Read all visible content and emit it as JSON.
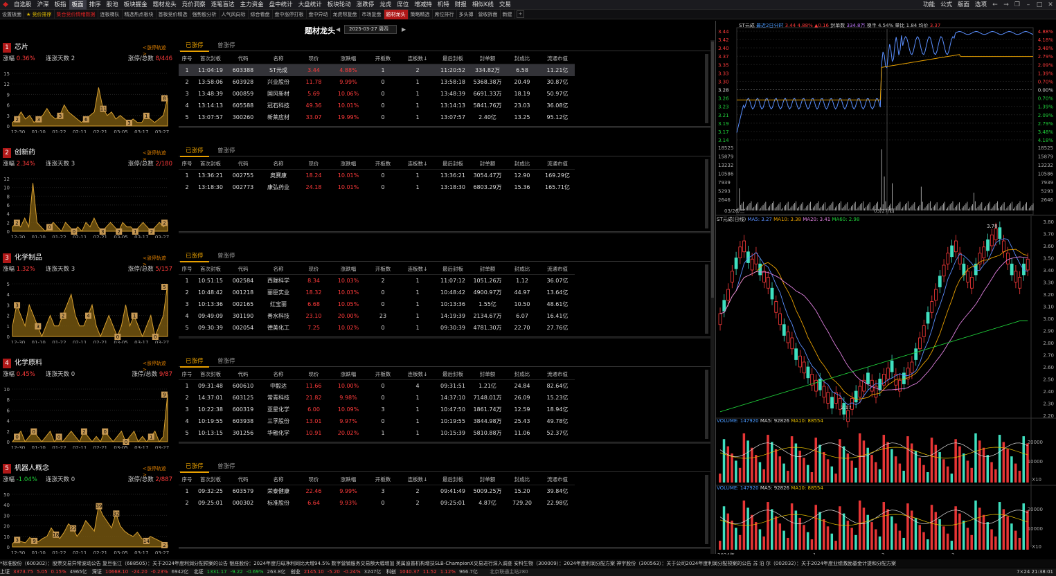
{
  "menubar": {
    "items": [
      "自选股",
      "沪深",
      "板指",
      "板面",
      "排序",
      "股池",
      "板块掘金",
      "题材龙头",
      "竞价洞察",
      "逐笔盲达",
      "主力资金",
      "盘中统计",
      "大盘统计",
      "板块轮动",
      "涨跌停",
      "龙虎",
      "席位",
      "增减持",
      "机特",
      "财报",
      "相似K线",
      "交易"
    ],
    "active": "板面",
    "right": [
      "功能",
      "公式",
      "版面",
      "选项"
    ]
  },
  "toolbar": {
    "items": [
      "设置板面",
      "★ 竞价排序",
      "集合竞价情绪数据",
      "连板梯队",
      "精选热点板块",
      "首板竞价精选",
      "强势股分析",
      "人气风向标",
      "综合看盘",
      "盘中涨停打板",
      "盘中异动",
      "龙虎帮复盘",
      "市场复盘",
      "题材龙头",
      "策略精选",
      "席位排行",
      "多头搏",
      "营收拆面",
      "新建"
    ],
    "active": "题材龙头"
  },
  "page": {
    "title": "题材龙头",
    "date": "2025-03-27 周四"
  },
  "tabs": [
    "已涨停",
    "曾涨停"
  ],
  "columns": [
    "序号",
    "首次封板",
    "代码",
    "名称",
    "现价",
    "涨跌幅",
    "开板数",
    "连板数↓",
    "最后封板",
    "封单额",
    "封成比",
    "流通市值"
  ],
  "sectors": [
    {
      "rank": "1",
      "name": "芯片",
      "track": "<涨停轨迹>",
      "change": "0.36%",
      "dir": "up",
      "days": "2",
      "limit": "8/446",
      "chart": {
        "labels": [
          "12-30",
          "01-10",
          "01-22",
          "02-11",
          "02-21",
          "03-05",
          "03-17",
          "03-27"
        ],
        "yticks": [
          "15",
          "12",
          "9",
          "6",
          "3",
          "0"
        ],
        "ymax": 15,
        "series": [
          1,
          2,
          4,
          2,
          3,
          1,
          2,
          3,
          5,
          3,
          2,
          3,
          6,
          4,
          3,
          2,
          1,
          2,
          3,
          4,
          11,
          5,
          3,
          4,
          2,
          3,
          2,
          1,
          2,
          1,
          1,
          3,
          2,
          1,
          2,
          3,
          8
        ],
        "labels_on": [
          {
            "i": 1,
            "v": "2"
          },
          {
            "i": 6,
            "v": "3"
          },
          {
            "i": 11,
            "v": "3"
          },
          {
            "i": 17,
            "v": "6"
          },
          {
            "i": 21,
            "v": "11"
          },
          {
            "i": 27,
            "v": "3"
          },
          {
            "i": 31,
            "v": "1"
          },
          {
            "i": 36,
            "v": "8"
          }
        ]
      },
      "rows": [
        [
          "1",
          "11:04:19",
          "603388",
          "ST元成",
          "3.44",
          "4.88%",
          "1",
          "2",
          "11:20:52",
          "334.82万",
          "6.58",
          "11.21亿"
        ],
        [
          "2",
          "13:58:06",
          "603928",
          "兴业股份",
          "11.78",
          "9.99%",
          "0",
          "1",
          "13:58:18",
          "5368.38万",
          "20.49",
          "30.87亿"
        ],
        [
          "3",
          "13:48:39",
          "000859",
          "国风新材",
          "5.69",
          "10.06%",
          "0",
          "1",
          "13:48:39",
          "6691.33万",
          "18.19",
          "50.97亿"
        ],
        [
          "4",
          "13:14:13",
          "605588",
          "冠石科技",
          "49.36",
          "10.01%",
          "0",
          "1",
          "13:14:13",
          "5841.76万",
          "23.03",
          "36.08亿"
        ],
        [
          "5",
          "13:07:57",
          "300260",
          "新莱应材",
          "33.07",
          "19.99%",
          "0",
          "1",
          "13:07:57",
          "2.40亿",
          "13.25",
          "95.12亿"
        ]
      ]
    },
    {
      "rank": "2",
      "name": "创新药",
      "track": "<涨停轨迹>",
      "change": "2.34%",
      "dir": "up",
      "days": "3",
      "limit": "2/180",
      "chart": {
        "labels": [
          "12-30",
          "01-10",
          "01-22",
          "02-11",
          "02-21",
          "03-05",
          "03-17",
          "03-27"
        ],
        "yticks": [
          "12",
          "10",
          "8",
          "6",
          "4",
          "2",
          "0"
        ],
        "ymax": 12,
        "series": [
          1,
          2,
          1,
          3,
          1,
          11,
          2,
          1,
          0,
          1,
          2,
          1,
          0,
          2,
          1,
          0,
          1,
          0,
          2,
          1,
          3,
          1,
          0,
          1,
          2,
          1,
          0,
          2,
          1,
          1,
          0,
          1,
          2,
          1,
          0,
          1,
          2,
          1,
          2
        ],
        "labels_on": [
          {
            "i": 1,
            "v": "2"
          },
          {
            "i": 9,
            "v": "0"
          },
          {
            "i": 15,
            "v": "0"
          },
          {
            "i": 22,
            "v": "3"
          },
          {
            "i": 26,
            "v": "2"
          },
          {
            "i": 30,
            "v": "1"
          },
          {
            "i": 34,
            "v": "2"
          },
          {
            "i": 38,
            "v": "2"
          }
        ]
      },
      "rows": [
        [
          "1",
          "13:36:21",
          "002755",
          "奥赛康",
          "18.24",
          "10.01%",
          "0",
          "1",
          "13:36:21",
          "3054.47万",
          "12.90",
          "169.29亿"
        ],
        [
          "2",
          "13:18:30",
          "002773",
          "康弘药业",
          "24.18",
          "10.01%",
          "0",
          "1",
          "13:18:30",
          "6803.29万",
          "15.36",
          "165.71亿"
        ]
      ]
    },
    {
      "rank": "3",
      "name": "化学制品",
      "track": "<涨停轨迹>",
      "change": "1.32%",
      "dir": "up",
      "days": "3",
      "limit": "5/157",
      "chart": {
        "labels": [
          "12-30",
          "01-10",
          "01-22",
          "02-11",
          "02-21",
          "03-05",
          "03-17",
          "03-27"
        ],
        "yticks": [
          "5",
          "4",
          "3",
          "2",
          "1",
          "0"
        ],
        "ymax": 5,
        "series": [
          1,
          3,
          2,
          1,
          3,
          2,
          1,
          0,
          1,
          2,
          1,
          1,
          2,
          3,
          4,
          2,
          1,
          1,
          2,
          3,
          1,
          0,
          1,
          2,
          1,
          0,
          1,
          3,
          1,
          2,
          1,
          0,
          1,
          2,
          0,
          1,
          2,
          5
        ],
        "labels_on": [
          {
            "i": 1,
            "v": "3"
          },
          {
            "i": 6,
            "v": "3"
          },
          {
            "i": 12,
            "v": "2"
          },
          {
            "i": 18,
            "v": "4"
          },
          {
            "i": 25,
            "v": "0"
          },
          {
            "i": 29,
            "v": "1"
          },
          {
            "i": 34,
            "v": "0"
          },
          {
            "i": 37,
            "v": "5"
          }
        ]
      },
      "rows": [
        [
          "1",
          "10:51:15",
          "002584",
          "西陇科学",
          "8.34",
          "10.03%",
          "2",
          "1",
          "11:07:12",
          "1051.26万",
          "1.12",
          "36.07亿"
        ],
        [
          "2",
          "10:48:42",
          "001218",
          "丽臣实业",
          "18.32",
          "10.03%",
          "0",
          "1",
          "10:48:42",
          "4900.97万",
          "44.97",
          "13.64亿"
        ],
        [
          "3",
          "10:13:36",
          "002165",
          "红宝丽",
          "6.68",
          "10.05%",
          "0",
          "1",
          "10:13:36",
          "1.55亿",
          "10.50",
          "48.61亿"
        ],
        [
          "4",
          "09:49:09",
          "301190",
          "善水科技",
          "23.10",
          "20.00%",
          "23",
          "1",
          "14:19:39",
          "2134.67万",
          "6.07",
          "16.41亿"
        ],
        [
          "5",
          "09:30:39",
          "002054",
          "德美化工",
          "7.25",
          "10.02%",
          "0",
          "1",
          "09:30:39",
          "4781.30万",
          "22.70",
          "27.76亿"
        ]
      ]
    },
    {
      "rank": "4",
      "name": "化学原料",
      "track": "<涨停轨迹>",
      "change": "0.45%",
      "dir": "up",
      "days": "0",
      "limit": "9/87",
      "chart": {
        "labels": [
          "12-30",
          "01-10",
          "01-22",
          "02-11",
          "02-21",
          "03-05",
          "03-17",
          "03-27"
        ],
        "yticks": [
          "10",
          "8",
          "6",
          "4",
          "2",
          "0"
        ],
        "ymax": 10,
        "series": [
          0,
          1,
          2,
          0,
          1,
          2,
          1,
          0,
          1,
          2,
          0,
          1,
          0,
          1,
          2,
          1,
          0,
          2,
          1,
          0,
          1,
          0,
          2,
          1,
          0,
          1,
          2,
          0,
          1,
          2,
          0,
          1,
          0,
          1,
          2,
          0,
          1,
          9
        ],
        "labels_on": [
          {
            "i": 1,
            "v": "0"
          },
          {
            "i": 5,
            "v": "0"
          },
          {
            "i": 11,
            "v": "0"
          },
          {
            "i": 17,
            "v": "2"
          },
          {
            "i": 22,
            "v": "0"
          },
          {
            "i": 27,
            "v": "0"
          },
          {
            "i": 33,
            "v": "1"
          },
          {
            "i": 37,
            "v": "9"
          }
        ]
      },
      "rows": [
        [
          "1",
          "09:31:48",
          "600610",
          "中毅达",
          "11.66",
          "10.00%",
          "0",
          "4",
          "09:31:51",
          "1.21亿",
          "24.84",
          "82.64亿"
        ],
        [
          "2",
          "14:37:01",
          "603125",
          "常青科技",
          "21.82",
          "9.98%",
          "0",
          "1",
          "14:37:10",
          "7148.01万",
          "26.09",
          "15.23亿"
        ],
        [
          "3",
          "10:22:38",
          "600319",
          "亚星化学",
          "6.00",
          "10.09%",
          "3",
          "1",
          "10:47:50",
          "1861.74万",
          "12.59",
          "18.94亿"
        ],
        [
          "4",
          "10:19:55",
          "603938",
          "三孚股份",
          "13.01",
          "9.97%",
          "0",
          "1",
          "10:19:55",
          "3844.98万",
          "25.43",
          "49.78亿"
        ],
        [
          "5",
          "10:13:15",
          "301256",
          "华融化学",
          "10.91",
          "20.02%",
          "1",
          "1",
          "10:15:39",
          "5810.88万",
          "11.06",
          "52.37亿"
        ]
      ]
    },
    {
      "rank": "5",
      "name": "机器人概念",
      "track": "<涨停轨迹>",
      "change": "-1.04%",
      "dir": "down",
      "days": "0",
      "limit": "2/887",
      "chart": {
        "labels": [
          "12-30",
          "01-10",
          "01-22",
          "02-11",
          "02-21",
          "03-05",
          "03-17",
          "03-27"
        ],
        "yticks": [
          "50",
          "40",
          "30",
          "20",
          "10",
          "0"
        ],
        "ymax": 50,
        "series": [
          3,
          7,
          5,
          4,
          9,
          6,
          5,
          8,
          10,
          18,
          12,
          8,
          14,
          22,
          18,
          10,
          16,
          25,
          20,
          15,
          39,
          30,
          24,
          18,
          32,
          20,
          15,
          12,
          10,
          14,
          8,
          6,
          10,
          8,
          6,
          4,
          2
        ],
        "labels_on": [
          {
            "i": 1,
            "v": "3"
          },
          {
            "i": 5,
            "v": "9"
          },
          {
            "i": 10,
            "v": "18"
          },
          {
            "i": 14,
            "v": "22"
          },
          {
            "i": 20,
            "v": "39"
          },
          {
            "i": 24,
            "v": "32"
          },
          {
            "i": 31,
            "v": "14"
          },
          {
            "i": 36,
            "v": "2"
          }
        ]
      },
      "rows": [
        [
          "1",
          "09:32:25",
          "603579",
          "荣泰健康",
          "22.46",
          "9.99%",
          "3",
          "2",
          "09:41:49",
          "5009.25万",
          "15.20",
          "39.84亿"
        ],
        [
          "2",
          "09:25:01",
          "000302",
          "标准股份",
          "6.64",
          "9.93%",
          "0",
          "2",
          "09:25:01",
          "4.87亿",
          "729.20",
          "22.98亿"
        ]
      ]
    }
  ],
  "right": {
    "intraday_title": {
      "name": "ST元成",
      "label": "最近2日分时",
      "price": "3.44",
      "pct": "4.88%",
      "chg": "▲0.16",
      "seal": "封单数",
      "seal_v": "334.8万",
      "turnover": "换手 4.54%",
      "vr": "量比 1.84",
      "avg": "均价",
      "avg_v": "3.37"
    },
    "price_left": [
      "3.44",
      "3.42",
      "3.40",
      "3.37",
      "3.35",
      "3.33",
      "3.30",
      "3.28",
      "3.26",
      "3.23",
      "3.21",
      "3.19",
      "3.17",
      "3.14"
    ],
    "price_right": [
      "4.88%",
      "4.18%",
      "3.48%",
      "2.79%",
      "2.09%",
      "1.39%",
      "0.70%",
      "0.00%",
      "0.70%",
      "1.39%",
      "2.09%",
      "2.79%",
      "3.48%",
      "4.18%"
    ],
    "vol_ticks": [
      "18525",
      "15879",
      "13232",
      "10586",
      "7939",
      "5293",
      "2646"
    ],
    "dates": [
      "03/26/三",
      "03/27/四"
    ],
    "kline_title": {
      "name": "ST元成(日线)",
      "ma5": "MA5: 3.27",
      "ma10": "MA10: 3.38",
      "ma20": "MA20: 3.41",
      "ma60": "MA60: 2.98"
    },
    "kline_ticks": [
      "3.80",
      "3.70",
      "3.60",
      "3.50",
      "3.40",
      "3.30",
      "3.20",
      "3.10",
      "3.00",
      "2.90",
      "2.80",
      "2.70",
      "2.60",
      "2.50",
      "2.40",
      "2.30",
      "2.20"
    ],
    "kline_hi": "3.78",
    "kline_lo": "2.17",
    "vol1_title": {
      "v": "VOLUME: 147920",
      "ma5": "MA5: 92826",
      "ma10": "MA10: 88554"
    },
    "vol2_title": {
      "v": "VOLUME: 147920",
      "ma5": "MA5: 92826",
      "ma10": "MA10: 88554"
    },
    "vol_axis": [
      "20000",
      "10000",
      "X10"
    ],
    "x_axis": [
      "2024年",
      "1",
      "2",
      "3"
    ]
  },
  "ticker": "*标准股份（600302）：股票交易异常波动公告      复旦张江（688505）：关于2024年度利润分配预案的公告      银座股份：2024年度归母净利同比大增94.5% 数字营销服务交易额大幅增加      英属迪普机构增扶SLB-ChampionX交易进行深入调查      安科生物（300009）：2024年度利润分配方案      神宇股份（300563）：关于公司2024年度利润分配预案的公告      苏 泊 尔（002032）：关于2024年度业绩激励基金计提和分配方案",
  "status": {
    "sh_label": "上证",
    "sh": "3373.75",
    "sh_c": "5.05",
    "sh_p": "0.15%",
    "sh_a": "4965亿",
    "sz_label": "深证",
    "sz": "10668.10",
    "sz_c": "-24.20",
    "sz_p": "-0.23%",
    "sz_a": "6942亿",
    "bz_label": "北证",
    "bz": "1331.17",
    "bz_c": "-9.22",
    "bz_p": "-0.69%",
    "bz_a": "263.8亿",
    "cy_label": "创业",
    "cy": "2145.10",
    "cy_c": "-5.20",
    "cy_p": "-0.24%",
    "cy_a": "3247亿",
    "kc_label": "科创",
    "kc": "1040.37",
    "kc_c": "11.52",
    "kc_p": "1.12%",
    "kc_a": "966.7亿",
    "server": "北京联通主站280",
    "right": "7×24",
    "time": "21:38:01"
  }
}
